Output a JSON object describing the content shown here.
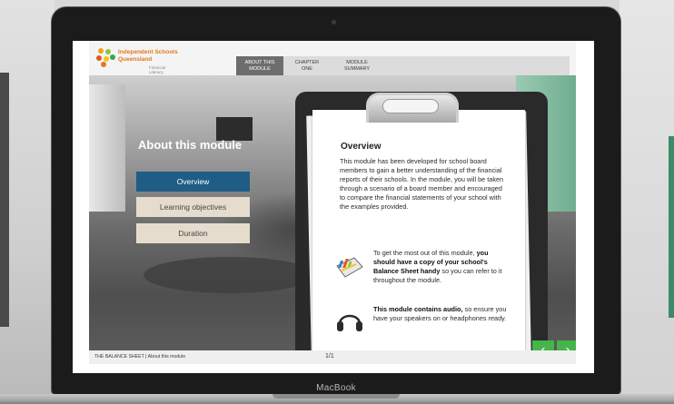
{
  "device": {
    "brand": "MacBook"
  },
  "header": {
    "logo_line1": "Independent Schools",
    "logo_line2": "Queensland",
    "logo_sub": "Financial Literacy",
    "tabs": [
      {
        "line1": "ABOUT THIS",
        "line2": "MODULE",
        "active": true
      },
      {
        "line1": "CHAPTER",
        "line2": "ONE",
        "active": false
      },
      {
        "line1": "MODULE",
        "line2": "SUMMARY",
        "active": false
      }
    ]
  },
  "sidebar": {
    "title": "About this module",
    "buttons": [
      {
        "label": "Overview",
        "active": true
      },
      {
        "label": "Learning objectives",
        "active": false
      },
      {
        "label": "Duration",
        "active": false
      }
    ]
  },
  "content": {
    "heading": "Overview",
    "body": "This module has been developed for school board members to gain a better understanding of the financial reports of their schools. In the module, you will be taken through a scenario of a board member and encouraged to compare the financial statements of your school with the examples provided.",
    "tip1_pre": "To get the most out of this module, ",
    "tip1_bold": "you should have a copy of your school's Balance Sheet handy",
    "tip1_post": " so you can refer to it throughout the module.",
    "tip2_bold": "This module contains audio,",
    "tip2_post": " so ensure you have your speakers on or headphones ready."
  },
  "footer": {
    "breadcrumb": "THE BALANCE SHEET | About this module",
    "page": "1/1"
  },
  "navigation": {
    "prev": "‹",
    "next": "›"
  },
  "colors": {
    "active_tab": "#6d6d6d",
    "active_button": "#1f5c86",
    "inactive_button": "#e6dccd",
    "nav_arrow": "#43b549",
    "logo_orange": "#e07a1a"
  },
  "icons": {
    "tip1": "balance-sheet-icon",
    "tip2": "headphones-icon"
  }
}
